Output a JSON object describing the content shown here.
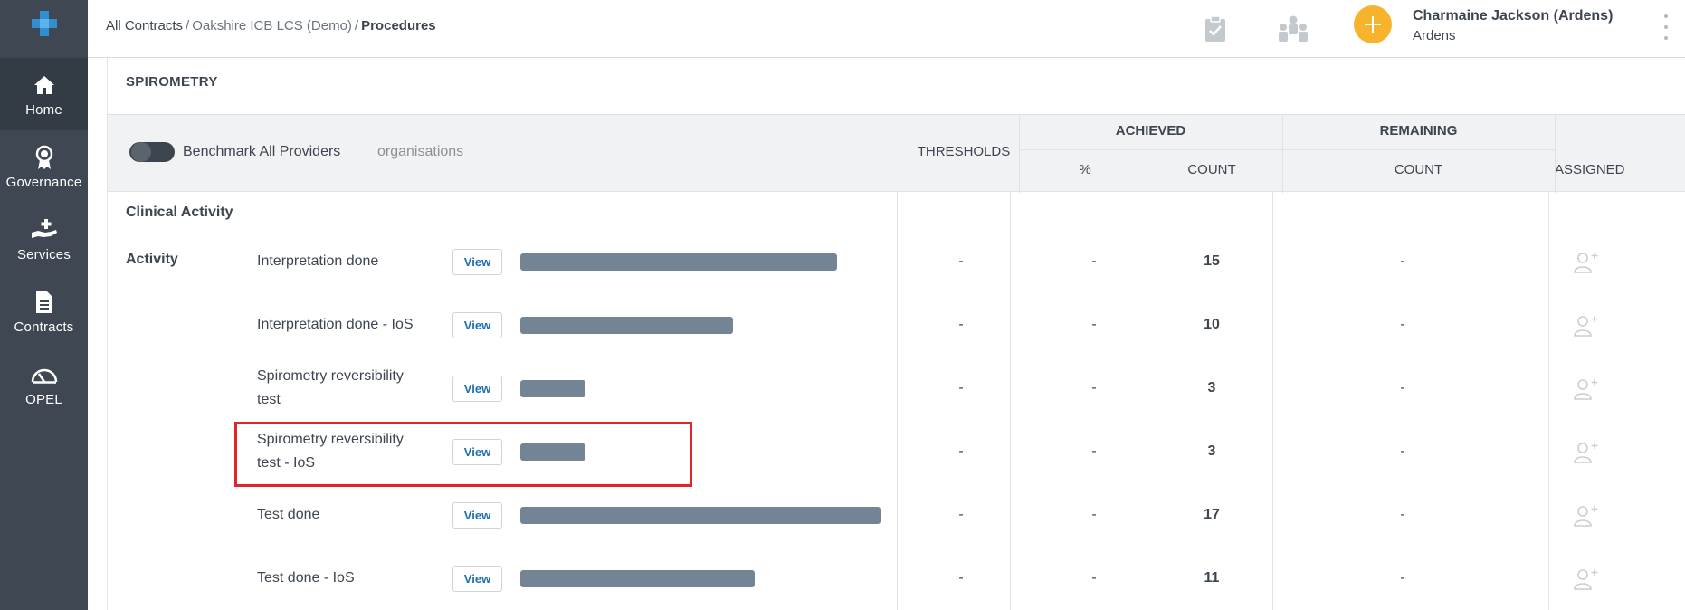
{
  "sidebar": {
    "logo_icon": "plus-cross-logo",
    "items": [
      {
        "label": "Home",
        "icon": "home-icon",
        "active": true
      },
      {
        "label": "Governance",
        "icon": "award-ribbon-icon",
        "active": false
      },
      {
        "label": "Services",
        "icon": "hand-plus-icon",
        "active": false
      },
      {
        "label": "Contracts",
        "icon": "document-icon",
        "active": false
      },
      {
        "label": "OPEL",
        "icon": "gauge-icon",
        "active": false
      }
    ]
  },
  "header": {
    "breadcrumb": {
      "root": "All Contracts",
      "middle": "Oakshire ICB LCS (Demo)",
      "current": "Procedures",
      "separator": "/"
    },
    "user": {
      "name": "Charmaine Jackson (Ardens)",
      "org": "Ardens"
    },
    "accent_color": "#f7b32b"
  },
  "panel": {
    "title": "SPIROMETRY",
    "benchmark_label": "Benchmark All Providers",
    "organisations_label": "organisations",
    "columns": {
      "thresholds": "THRESHOLDS",
      "achieved": "ACHIEVED",
      "achieved_pct": "%",
      "achieved_count": "COUNT",
      "remaining": "REMAINING",
      "remaining_count": "COUNT",
      "assigned": "ASSIGNED"
    },
    "group_title": "Clinical Activity",
    "activity_label": "Activity",
    "view_label": "View",
    "bar_color": "#738594",
    "highlight_color": "#e1262b",
    "rows": [
      {
        "label": "Interpretation done",
        "threshold": "-",
        "pct": "-",
        "count": "15",
        "remaining": "-",
        "bar_fraction": 0.88
      },
      {
        "label": "Interpretation done - IoS",
        "threshold": "-",
        "pct": "-",
        "count": "10",
        "remaining": "-",
        "bar_fraction": 0.59
      },
      {
        "label": "Spirometry reversibility test",
        "threshold": "-",
        "pct": "-",
        "count": "3",
        "remaining": "-",
        "bar_fraction": 0.18
      },
      {
        "label": "Spirometry reversibility test - IoS",
        "threshold": "-",
        "pct": "-",
        "count": "3",
        "remaining": "-",
        "bar_fraction": 0.18
      },
      {
        "label": "Test done",
        "threshold": "-",
        "pct": "-",
        "count": "17",
        "remaining": "-",
        "bar_fraction": 1.0
      },
      {
        "label": "Test done - IoS",
        "threshold": "-",
        "pct": "-",
        "count": "11",
        "remaining": "-",
        "bar_fraction": 0.65
      }
    ]
  }
}
